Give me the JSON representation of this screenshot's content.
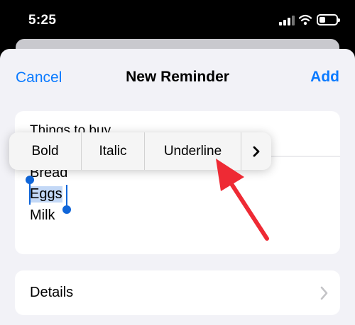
{
  "status": {
    "time": "5:25"
  },
  "nav": {
    "cancel": "Cancel",
    "title": "New Reminder",
    "add": "Add"
  },
  "reminder": {
    "title": "Things to buy",
    "notes": [
      "Bread",
      "Eggs",
      "Milk"
    ],
    "selected_line": "Eggs"
  },
  "format_menu": {
    "items": [
      "Bold",
      "Italic",
      "Underline"
    ],
    "more_label": "›"
  },
  "details": {
    "label": "Details"
  },
  "colors": {
    "accent": "#0a7aff",
    "selection": "#1066d9",
    "annotation": "#ee2a34"
  }
}
